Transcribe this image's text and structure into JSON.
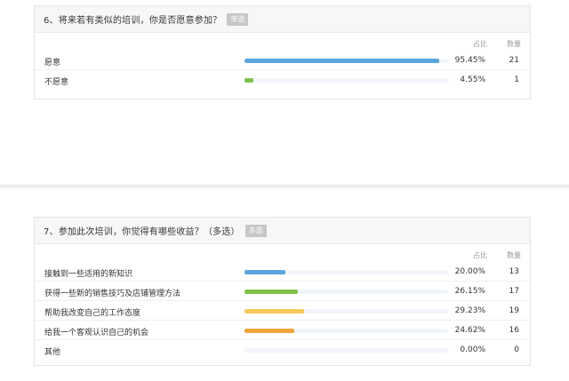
{
  "col_headers": {
    "percent": "占比",
    "count": "数量"
  },
  "questions": [
    {
      "title": "6、将来若有类似的培训，你是否愿意参加？",
      "tag": "单选",
      "options": [
        {
          "label": "愿意",
          "percent": "95.45%",
          "count": "21",
          "fraction": 0.9545,
          "color": "#5aa6dc"
        },
        {
          "label": "不愿意",
          "percent": "4.55%",
          "count": "1",
          "fraction": 0.0455,
          "color": "#7dc14c"
        }
      ]
    },
    {
      "title": "7、参加此次培训，你觉得有哪些收益？（多选）",
      "tag": "多选",
      "options": [
        {
          "label": "接触到一些适用的新知识",
          "percent": "20.00%",
          "count": "13",
          "fraction": 0.2,
          "color": "#5aa6dc"
        },
        {
          "label": "获得一些新的销售技巧及店铺管理方法",
          "percent": "26.15%",
          "count": "17",
          "fraction": 0.2615,
          "color": "#7dc14c"
        },
        {
          "label": "帮助我改变自己的工作态度",
          "percent": "29.23%",
          "count": "19",
          "fraction": 0.2923,
          "color": "#f5c85a"
        },
        {
          "label": "给我一个客观认识自己的机会",
          "percent": "24.62%",
          "count": "16",
          "fraction": 0.2462,
          "color": "#eba538"
        },
        {
          "label": "其他",
          "percent": "0.00%",
          "count": "0",
          "fraction": 0.0,
          "color": "#5aa6dc"
        }
      ]
    }
  ]
}
